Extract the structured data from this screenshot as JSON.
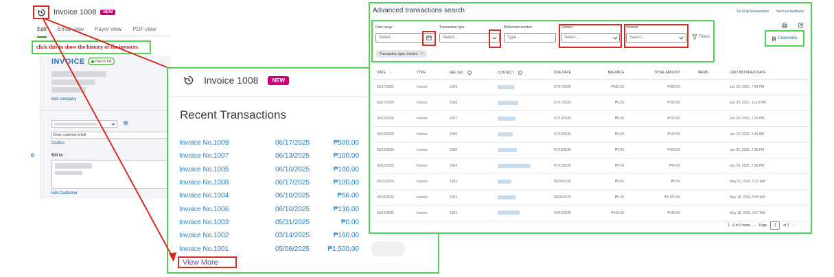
{
  "invoice_editor": {
    "title": "Invoice 1008",
    "new_badge": "NEW",
    "tabs": [
      "Edit",
      "Email view",
      "Payor view",
      "PDF view"
    ],
    "annotation": "click this to show the history of the invoices.",
    "invoice_word": "INVOICE",
    "paid_status": "Paid in full",
    "edit_company": "Edit company",
    "email_placeholder": "Enter customer email",
    "cc_bcc": "Cc/Bcc",
    "bill_to": "Bill to",
    "edit_customer": "Edit Customer",
    "icons": [
      "history-icon",
      "chevron-down-icon",
      "snowflake-icon",
      "gear-icon"
    ]
  },
  "recent_transactions": {
    "title": "Invoice 1008",
    "new_badge": "NEW",
    "heading": "Recent Transactions",
    "rows": [
      {
        "invoice": "Invoice No.1009",
        "date": "06/17/2025",
        "amount": "₱500.00"
      },
      {
        "invoice": "Invoice No.1007",
        "date": "06/13/2025",
        "amount": "₱100.00"
      },
      {
        "invoice": "Invoice No.1005",
        "date": "06/10/2025",
        "amount": "₱100.00"
      },
      {
        "invoice": "Invoice No.1008",
        "date": "06/17/2025",
        "amount": "₱100.00"
      },
      {
        "invoice": "Invoice No.1004",
        "date": "06/10/2025",
        "amount": "₱56.00"
      },
      {
        "invoice": "Invoice No.1006",
        "date": "06/10/2025",
        "amount": "₱130.00"
      },
      {
        "invoice": "Invoice No.1003",
        "date": "05/31/2025",
        "amount": "₱0.00"
      },
      {
        "invoice": "Invoice No.1002",
        "date": "03/14/2025",
        "amount": "₱160.00"
      },
      {
        "invoice": "Invoice No.1001",
        "date": "05/06/2025",
        "amount": "₱1,500.00"
      }
    ],
    "view_more": "View More"
  },
  "advanced_search": {
    "title": "Advanced transactions search",
    "link_all": "Go to all transactions",
    "link_sep": "→",
    "link_feedback": "Send us feedback",
    "filters": {
      "date_range": {
        "label": "Date range",
        "placeholder": "Select..."
      },
      "transaction_type": {
        "label": "Transaction type",
        "placeholder": "Select..."
      },
      "reference_number": {
        "label": "Reference number",
        "placeholder": "Type..."
      },
      "contact": {
        "label": "Contact",
        "placeholder": "Select..."
      },
      "amount": {
        "label": "Amount",
        "placeholder": "Select..."
      },
      "filters_button": "Filters"
    },
    "active_chip": "Transaction type: Invoice",
    "chip_remove": "×",
    "customize": "Customize",
    "columns": [
      "DATE",
      "TYPE",
      "REF NO.",
      "CONTACT",
      "DUE DATE",
      "BALANCE",
      "TOTAL AMOUNT",
      "MEMO",
      "LAST MODIFIED DATE"
    ],
    "rows": [
      {
        "date": "06/17/2025",
        "type": "Invoice",
        "ref": "1009",
        "due": "07/17/2025",
        "balance": "₱500.00",
        "total": "₱500.00",
        "memo": "",
        "modified": "Jun 20, 2025, 7:43 PM"
      },
      {
        "date": "06/17/2025",
        "type": "Invoice",
        "ref": "1008",
        "due": "07/17/2025",
        "balance": "₱0.00",
        "total": "₱100.00",
        "memo": "",
        "modified": "Jun 29, 2025, 11:19 PM"
      },
      {
        "date": "06/13/2025",
        "type": "Invoice",
        "ref": "1007",
        "due": "07/13/2025",
        "balance": "₱0.00",
        "total": "₱100.00",
        "memo": "",
        "modified": "Jun 20, 2025, 7:26 PM"
      },
      {
        "date": "06/10/2025",
        "type": "Invoice",
        "ref": "1006",
        "due": "07/10/2025",
        "balance": "₱0.00",
        "total": "₱130.00",
        "memo": "",
        "modified": "Jun 14, 2025, 1:43 AM"
      },
      {
        "date": "06/10/2025",
        "type": "Invoice",
        "ref": "1005",
        "due": "07/10/2025",
        "balance": "₱0.00",
        "total": "₱100.00",
        "memo": "",
        "modified": "Jun 20, 2025, 7:36 PM"
      },
      {
        "date": "06/10/2025",
        "type": "Invoice",
        "ref": "1004",
        "due": "07/10/2025",
        "balance": "₱0.00",
        "total": "₱56.00",
        "memo": "",
        "modified": "Jun 20, 2025, 7:36 PM"
      },
      {
        "date": "05/31/2025",
        "type": "Invoice",
        "ref": "1003",
        "due": "06/30/2025",
        "balance": "₱0.00",
        "total": "₱0.00",
        "memo": "",
        "modified": "May 31, 2025, 5:32 AM"
      },
      {
        "date": "05/06/2025",
        "type": "Invoice",
        "ref": "1001",
        "due": "06/05/2025",
        "balance": "₱0.00",
        "total": "₱1,500.00",
        "memo": "",
        "modified": "May 18, 2025, 5:55 AM"
      },
      {
        "date": "03/14/2025",
        "type": "Invoice",
        "ref": "1002",
        "due": "04/13/2025",
        "balance": "₱160.00",
        "total": "₱160.00",
        "memo": "",
        "modified": "May 18, 2025, 6:07 AM"
      }
    ],
    "pagination": {
      "range": "1 - 9 of 9 items",
      "page_label": "Page",
      "page": "1",
      "of": "of 1"
    }
  },
  "colors": {
    "highlight_green": "#4fd24f",
    "highlight_red": "#d52b1e",
    "link_blue": "#1e7fc4",
    "new_badge": "#c9007a",
    "paid_green": "#2ca01c"
  }
}
